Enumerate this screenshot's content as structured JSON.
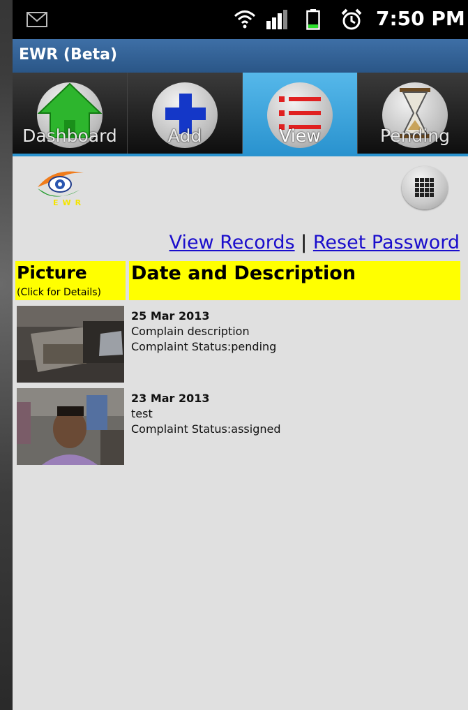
{
  "status_bar": {
    "time": "7:50 PM",
    "icons": [
      "mail-icon",
      "wifi-icon",
      "signal-icon",
      "battery-icon",
      "alarm-icon"
    ]
  },
  "app": {
    "title": "EWR (Beta)"
  },
  "tabs": [
    {
      "label": "Dashboard",
      "icon": "home-icon",
      "active": false
    },
    {
      "label": "Add",
      "icon": "plus-icon",
      "active": false
    },
    {
      "label": "View",
      "icon": "list-icon",
      "active": true
    },
    {
      "label": "Pending",
      "icon": "hourglass-icon",
      "active": false
    }
  ],
  "logo": {
    "text": "EWR",
    "icon": "eye-logo"
  },
  "links": {
    "view_records": "View Records",
    "separator": "|",
    "reset_password": "Reset Password"
  },
  "table": {
    "col_picture": "Picture",
    "col_picture_hint": "(Click for Details)",
    "col_desc": "Date and Description",
    "rows": [
      {
        "date": "25 Mar 2013",
        "description": "Complain description",
        "status": "Complaint Status:pending"
      },
      {
        "date": "23 Mar 2013",
        "description": "test",
        "status": "Complaint Status:assigned"
      }
    ]
  },
  "colors": {
    "header_yellow": "#ffff00",
    "link_blue": "#1a0dcc",
    "tab_active": "#2a93cf",
    "titlebar": "#2a5687"
  }
}
